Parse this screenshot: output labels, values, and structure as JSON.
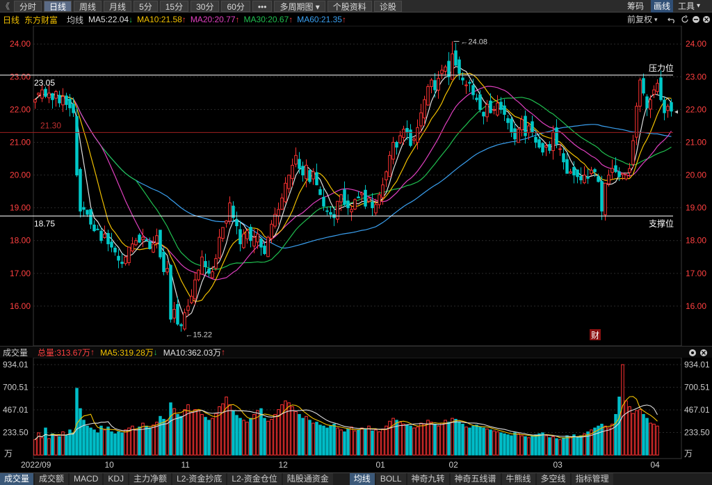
{
  "toolbar": {
    "collapse_glyph": "《",
    "tabs": [
      "分时",
      "日线",
      "周线",
      "月线",
      "5分",
      "15分",
      "30分",
      "60分",
      "•••",
      "多周期图 ▾",
      "个股资料",
      "诊股"
    ],
    "active_index": 1,
    "right": {
      "chips": "筹码",
      "draw": "画线",
      "tools": "工具",
      "tools_arrow": "▾"
    }
  },
  "main_info": {
    "period": "日线",
    "stock_name": "东方财富",
    "avg_label": "均线",
    "ma": [
      {
        "text": "MA5:22.04",
        "arrow": "↓",
        "color": "#e0e0e0",
        "arrow_color": "#22c45a"
      },
      {
        "text": "MA10:21.58",
        "arrow": "↑",
        "color": "#f2c100",
        "arrow_color": "#ff4040"
      },
      {
        "text": "MA20:20.77",
        "arrow": "↑",
        "color": "#e040c0",
        "arrow_color": "#ff4040"
      },
      {
        "text": "MA30:20.67",
        "arrow": "↑",
        "color": "#20c050",
        "arrow_color": "#ff4040"
      },
      {
        "text": "MA60:21.35",
        "arrow": "↑",
        "color": "#3aa0f0",
        "arrow_color": "#ff4040"
      }
    ],
    "restore": "前复权",
    "restore_arrow": "▾",
    "icons": [
      "undo",
      "refresh",
      "minus",
      "close"
    ]
  },
  "colors": {
    "up": "#ff3232",
    "down": "#00c8c8",
    "vol_up": "#ff3232",
    "vol_down": "#00bdc8",
    "ma5": "#e0e0e0",
    "ma10": "#f2c100",
    "ma20": "#e040c0",
    "ma30": "#20c050",
    "ma60": "#3aa0f0",
    "axis": "#ff4040",
    "grid": "#2a2a2a"
  },
  "price_axis": {
    "labels": [
      "24.00",
      "23.00",
      "22.00",
      "21.00",
      "20.00",
      "19.00",
      "18.00",
      "17.00",
      "16.00"
    ]
  },
  "annotations": {
    "resistance_value": "23.05",
    "resistance_label": "压力位",
    "support_value": "18.75",
    "support_label": "支撑位",
    "mid_value": "21.30",
    "high_label": "24.08",
    "low_label": "15.22",
    "fin_badge": "财",
    "marker_glyph": "◂"
  },
  "volume_info": {
    "label": "成交量",
    "total": "总量:313.67万",
    "total_arrow": "↑",
    "ma5": "MA5:319.28万",
    "ma5_arrow": "↓",
    "ma10": "MA10:362.03万",
    "ma10_arrow": "↑",
    "icons": [
      "settings",
      "close"
    ]
  },
  "volume_axis": {
    "labels": [
      "934.01",
      "700.51",
      "467.01",
      "233.50"
    ],
    "unit": "万"
  },
  "date_axis": {
    "labels": [
      "2022/09",
      "10",
      "11",
      "12",
      "01",
      "02",
      "03",
      "04"
    ]
  },
  "bottom_tabs": {
    "left": [
      "成交量",
      "成交额",
      "MACD",
      "KDJ",
      "主力净额",
      "L2-资金抄底",
      "L2-资金仓位",
      "陆股通资金"
    ],
    "right": [
      "均线",
      "BOLL",
      "神奇九转",
      "神奇五线谱",
      "牛熊线",
      "多空线",
      "指标管理"
    ],
    "left_active": 0,
    "right_active": 0
  },
  "chart_data": {
    "type": "candlestick",
    "ylim": [
      15.0,
      24.45
    ],
    "volume_max": 934.01,
    "resistance": 23.05,
    "support": 18.75,
    "mid": 21.3,
    "high": {
      "index": 120,
      "value": 24.08
    },
    "low": {
      "index": 42,
      "value": 15.22
    },
    "closes": [
      22.3,
      22.5,
      22.6,
      22.4,
      22.5,
      22.3,
      22.55,
      22.2,
      22.4,
      22.15,
      22.05,
      21.9,
      20.0,
      18.9,
      18.95,
      18.8,
      18.5,
      18.3,
      18.35,
      18.0,
      18.2,
      17.9,
      17.8,
      17.65,
      17.4,
      17.3,
      17.5,
      17.8,
      17.9,
      18.0,
      17.95,
      18.1,
      18.0,
      17.75,
      17.9,
      18.15,
      17.5,
      17.05,
      17.15,
      15.6,
      15.9,
      15.45,
      15.4,
      15.8,
      16.0,
      16.3,
      16.8,
      17.1,
      17.5,
      17.2,
      17.0,
      17.05,
      17.45,
      18.1,
      18.4,
      18.6,
      19.15,
      18.7,
      18.45,
      17.9,
      18.2,
      18.3,
      18.0,
      18.1,
      18.2,
      17.8,
      17.6,
      18.1,
      18.5,
      18.8,
      18.95,
      19.3,
      19.75,
      20.0,
      20.3,
      20.6,
      20.2,
      20.0,
      20.3,
      19.8,
      20.1,
      19.7,
      19.4,
      19.05,
      18.9,
      18.8,
      18.7,
      19.2,
      19.4,
      19.1,
      19.0,
      18.95,
      19.25,
      19.3,
      19.45,
      19.05,
      19.3,
      19.0,
      19.1,
      19.4,
      19.7,
      20.1,
      20.6,
      21.0,
      20.85,
      21.2,
      21.4,
      21.3,
      20.9,
      21.1,
      21.45,
      21.9,
      22.3,
      22.7,
      22.9,
      22.6,
      22.95,
      23.2,
      23.3,
      23.0,
      23.7,
      23.35,
      23.1,
      22.9,
      22.75,
      22.8,
      22.45,
      22.3,
      22.0,
      21.8,
      22.15,
      21.9,
      22.0,
      22.2,
      22.0,
      21.85,
      21.6,
      21.3,
      21.1,
      21.4,
      21.7,
      21.2,
      21.5,
      21.3,
      21.0,
      20.85,
      20.7,
      20.9,
      20.75,
      21.3,
      20.95,
      20.8,
      20.4,
      20.05,
      20.1,
      20.0,
      19.95,
      19.85,
      20.0,
      19.9,
      20.15,
      20.1,
      19.8,
      18.9,
      19.75,
      20.0,
      20.2,
      20.1,
      19.95,
      20.05,
      20.0,
      20.2,
      21.05,
      22.1,
      22.9,
      22.5,
      22.05,
      22.3,
      22.6,
      22.8,
      22.3,
      21.9,
      22.1,
      21.95
    ],
    "volumes": [
      160,
      230,
      180,
      280,
      170,
      220,
      200,
      190,
      240,
      200,
      260,
      230,
      690,
      480,
      360,
      300,
      280,
      260,
      230,
      300,
      260,
      290,
      240,
      220,
      240,
      230,
      260,
      280,
      300,
      270,
      290,
      330,
      300,
      280,
      310,
      340,
      400,
      370,
      360,
      540,
      480,
      420,
      400,
      470,
      520,
      440,
      470,
      460,
      420,
      390,
      360,
      380,
      430,
      500,
      530,
      600,
      520,
      460,
      410,
      380,
      360,
      340,
      380,
      420,
      460,
      480,
      380,
      350,
      370,
      420,
      470,
      520,
      560,
      540,
      500,
      450,
      420,
      380,
      400,
      360,
      330,
      340,
      310,
      300,
      280,
      300,
      320,
      280,
      260,
      240,
      270,
      290,
      250,
      260,
      280,
      270,
      300,
      250,
      260,
      240,
      270,
      300,
      350,
      380,
      360,
      340,
      320,
      310,
      300,
      280,
      290,
      330,
      320,
      360,
      340,
      320,
      300,
      330,
      360,
      340,
      380,
      370,
      340,
      320,
      290,
      280,
      300,
      310,
      290,
      280,
      270,
      260,
      250,
      240,
      230,
      220,
      210,
      200,
      230,
      220,
      200,
      190,
      180,
      200,
      210,
      220,
      230,
      200,
      180,
      190,
      170,
      160,
      180,
      200,
      190,
      210,
      180,
      200,
      220,
      240,
      260,
      280,
      300,
      320,
      300,
      280,
      320,
      420,
      600,
      934,
      560,
      500,
      430,
      460,
      470,
      420,
      380,
      330,
      320,
      300
    ]
  }
}
